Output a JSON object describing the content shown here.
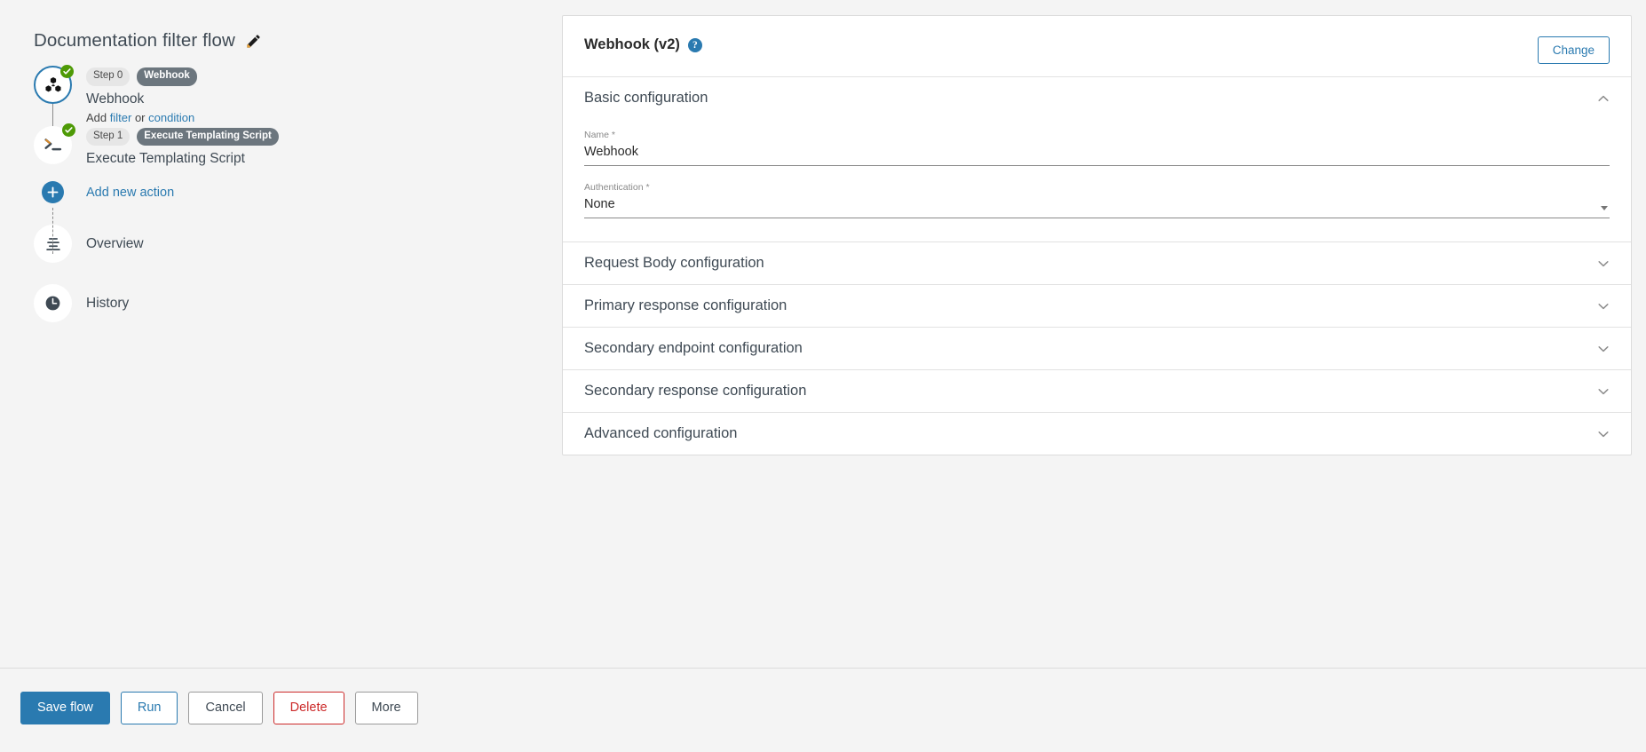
{
  "flow": {
    "title": "Documentation filter flow",
    "edit_icon": "pencil-icon",
    "nodes": [
      {
        "icon": "cubes-icon",
        "step_chip": "Step 0",
        "type_chip": "Webhook",
        "name": "Webhook",
        "status": "valid"
      },
      {
        "icon": "terminal-icon",
        "step_chip": "Step 1",
        "type_chip": "Execute Templating Script",
        "name": "Execute Templating Script",
        "status": "valid"
      }
    ],
    "add_between": {
      "prefix": "Add",
      "filter_link": "filter",
      "separator": "or",
      "condition_link": "condition"
    },
    "add_action_label": "Add new action",
    "add_action_icon": "plus-icon"
  },
  "nav": [
    {
      "label": "Overview",
      "icon": "list-lines-icon"
    },
    {
      "label": "History",
      "icon": "clock-icon"
    }
  ],
  "panel": {
    "title": "Webhook (v2)",
    "help_icon": "question-mark-icon",
    "change_button": "Change",
    "sections": [
      {
        "title": "Basic configuration",
        "expanded": true,
        "chevron": "chevron-up-icon",
        "fields": [
          {
            "label": "Name *",
            "value": "Webhook",
            "placeholder": "",
            "type": "text",
            "name": "name-field"
          },
          {
            "label": "Authentication *",
            "value": "None",
            "placeholder": "",
            "type": "select",
            "name": "authentication-select"
          }
        ]
      },
      {
        "title": "Request Body configuration",
        "expanded": false,
        "chevron": "chevron-down-icon"
      },
      {
        "title": "Primary response configuration",
        "expanded": false,
        "chevron": "chevron-down-icon"
      },
      {
        "title": "Secondary endpoint configuration",
        "expanded": false,
        "chevron": "chevron-down-icon"
      },
      {
        "title": "Secondary response configuration",
        "expanded": false,
        "chevron": "chevron-down-icon"
      },
      {
        "title": "Advanced configuration",
        "expanded": false,
        "chevron": "chevron-down-icon"
      }
    ]
  },
  "footer": {
    "buttons": [
      {
        "label": "Save flow",
        "style": "primary"
      },
      {
        "label": "Run",
        "style": "blue"
      },
      {
        "label": "Cancel",
        "style": "plain"
      },
      {
        "label": "Delete",
        "style": "danger"
      },
      {
        "label": "More",
        "style": "plain"
      }
    ]
  },
  "colors": {
    "accent": "#2a7ab0",
    "success": "#4e9a06",
    "danger": "#cc2a2a",
    "chip_type_bg": "#6c767e",
    "page_bg": "#f4f4f4"
  }
}
